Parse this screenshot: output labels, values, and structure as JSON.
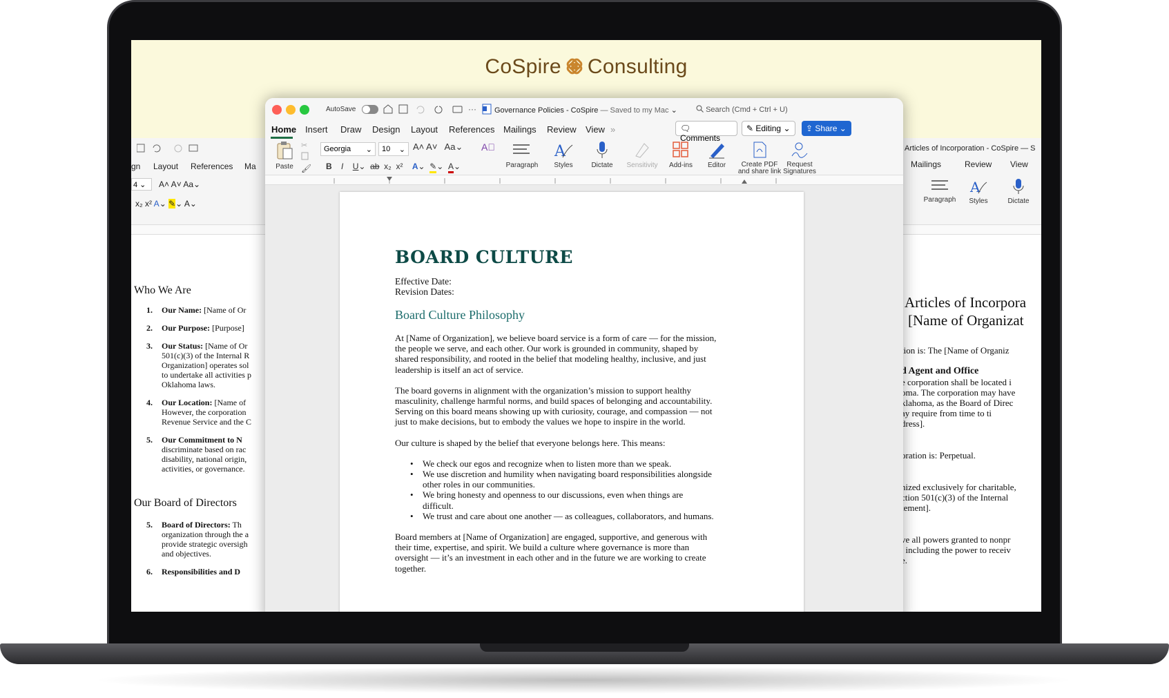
{
  "brand": {
    "name_left": "CoSpire",
    "name_right": "Consulting",
    "accent": "#c9852d"
  },
  "left_window": {
    "tabs": [
      "gn",
      "Layout",
      "References",
      "Ma"
    ],
    "sections": [
      {
        "heading": "Who We Are",
        "items": [
          {
            "num": "1.",
            "bold": "Our Name:",
            "text": " [Name of Or"
          },
          {
            "num": "2.",
            "bold": "Our Purpose:",
            "text": " [Purpose]"
          },
          {
            "num": "3.",
            "bold": "Our Status:",
            "text": " [Name of Or",
            "lines": [
              "501(c)(3) of the Internal R",
              "Organization] operates sol",
              "to undertake all activities p",
              "Oklahoma laws."
            ]
          },
          {
            "num": "4.",
            "bold": "Our Location:",
            "text": " [Name of",
            "lines": [
              "However, the corporation",
              "Revenue Service and the C"
            ]
          },
          {
            "num": "5.",
            "bold": "Our Commitment to N",
            "text": "",
            "lines": [
              "discriminate based on rac",
              "disability, national origin,",
              "activities, or governance."
            ]
          }
        ]
      },
      {
        "heading": "Our Board of Directors",
        "items": [
          {
            "num": "5.",
            "bold": "Board of Directors:",
            "text": " Th",
            "lines": [
              "organization through the a",
              "provide strategic oversigh",
              "and objectives."
            ]
          },
          {
            "num": "6.",
            "bold": "Responsibilities and D",
            "text": ""
          }
        ]
      }
    ]
  },
  "right_window": {
    "title": "Articles of Incorporation - CoSpire — S",
    "tabs": [
      "Mailings",
      "Review",
      "View"
    ],
    "tools": [
      "Paragraph",
      "Styles",
      "Dictate"
    ],
    "heading1": "Articles of Incorpora",
    "heading2": "[Name of Organizat",
    "lines": [
      "tion is: The [Name of Organiz",
      "d Agent and Office",
      "e corporation shall be located i",
      "oma. The corporation may have",
      "klahoma, as the Board of Direc",
      "ay require from time to ti",
      "dress].",
      "oration is: Perpetual.",
      "nized exclusively for charitable,",
      "ction 501(c)(3) of the Internal",
      "tement].",
      "ve all powers granted to nonpr",
      ", including the power to receiv",
      "e."
    ]
  },
  "main_window": {
    "autosave": "AutoSave",
    "title": "Governance Policies - CoSpire",
    "saved": "— Saved to my Mac",
    "search_placeholder": "Search (Cmd + Ctrl + U)",
    "tabs": [
      "Home",
      "Insert",
      "Draw",
      "Design",
      "Layout",
      "References",
      "Mailings",
      "Review",
      "View"
    ],
    "active_tab": "Home",
    "comments": "Comments",
    "editing": "Editing",
    "share": "Share",
    "font": "Georgia",
    "font_size": "10",
    "tools": {
      "paste": "Paste",
      "paragraph": "Paragraph",
      "styles": "Styles",
      "dictate": "Dictate",
      "sensitivity": "Sensitivity",
      "addins": "Add-ins",
      "editor": "Editor",
      "pdf1": "Create PDF",
      "pdf2": "and share link",
      "sig1": "Request",
      "sig2": "Signatures"
    },
    "format_buttons": [
      "B",
      "I",
      "U",
      "ab",
      "x₂",
      "x²"
    ]
  },
  "document": {
    "title": "BOARD CULTURE",
    "effective": "Effective Date:",
    "revision": "Revision Dates:",
    "h2": "Board Culture Philosophy",
    "p1": [
      "At [Name of Organization], we believe board service is a form of care — for the mission,",
      "the people we serve, and each other. Our work is grounded in community, shaped by",
      "shared responsibility, and rooted in the belief that modeling healthy, inclusive, and just",
      "leadership is itself an act of service."
    ],
    "p2": [
      "The board governs in alignment with the organization’s mission to support healthy",
      "masculinity, challenge harmful norms, and build spaces of belonging and accountability.",
      "Serving on this board means showing up with curiosity, courage, and compassion — not",
      "just to make decisions, but to embody the values we hope to inspire in the world."
    ],
    "p3": "Our culture is shaped by the belief that everyone belongs here. This means:",
    "bullets": [
      [
        "We check our egos and recognize when to listen more than we speak."
      ],
      [
        "We use discretion and humility when navigating board responsibilities alongside",
        "other roles in our communities."
      ],
      [
        "We bring honesty and openness to our discussions, even when things are",
        "difficult."
      ],
      [
        "We trust and care about one another — as colleagues, collaborators, and humans."
      ]
    ],
    "p4": [
      "Board members at [Name of Organization] are engaged, supportive, and generous with",
      "their time, expertise, and spirit. We build a culture where governance is more than",
      "oversight — it’s an investment in each other and in the future we are working to create",
      "together."
    ]
  }
}
